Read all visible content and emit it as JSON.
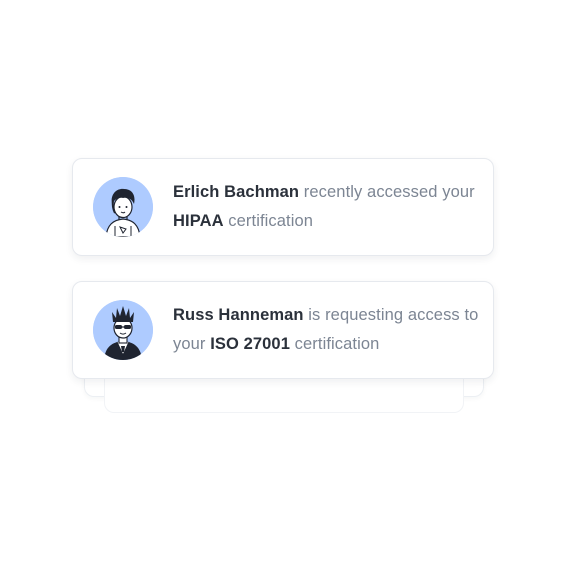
{
  "notifications": [
    {
      "name": "Erlich Bachman",
      "action": " recently accessed your ",
      "certification": "HIPAA",
      "suffix": " certification",
      "avatar_icon": "person-avatar-icon"
    },
    {
      "name": "Russ Hanneman",
      "action": " is requesting access to your ",
      "certification": "ISO 27001",
      "suffix": " certification",
      "avatar_icon": "person-avatar-icon"
    }
  ],
  "colors": {
    "avatar_background": "#aecbff",
    "name_text": "#2b313b",
    "body_text": "#7c8593"
  }
}
